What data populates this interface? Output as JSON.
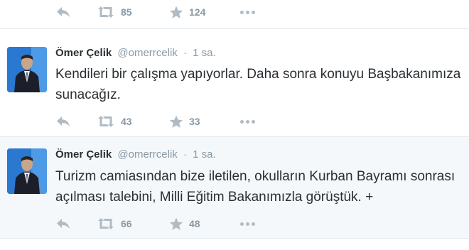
{
  "top_actions": {
    "retweets": "85",
    "favorites": "124"
  },
  "tweets": [
    {
      "fullname": "Ömer Çelik",
      "username": "@omerrcelik",
      "separator": "·",
      "time": "1 sa.",
      "text_line1": "Kendileri bir çalışma yapıyorlar. Daha sonra konuyu Başbakanımıza",
      "text_line2": "sunacağız.",
      "retweets": "43",
      "favorites": "33"
    },
    {
      "fullname": "Ömer Çelik",
      "username": "@omerrcelik",
      "separator": "·",
      "time": "1 sa.",
      "text_line1": "Turizm camiasından bize iletilen, okulların Kurban Bayramı sonrası",
      "text_line2": "açılması talebini, Milli Eğitim Bakanımızla görüştük. +",
      "retweets": "66",
      "favorites": "48"
    }
  ],
  "icons": {
    "reply": "reply-icon",
    "retweet": "retweet-icon",
    "favorite": "star-icon",
    "more": "more-dots-icon"
  },
  "colors": {
    "icon_gray": "#b1bbc3",
    "text_gray": "#8899a6",
    "highlight_bg": "#f5f8fa",
    "border": "#e1e8ed"
  }
}
